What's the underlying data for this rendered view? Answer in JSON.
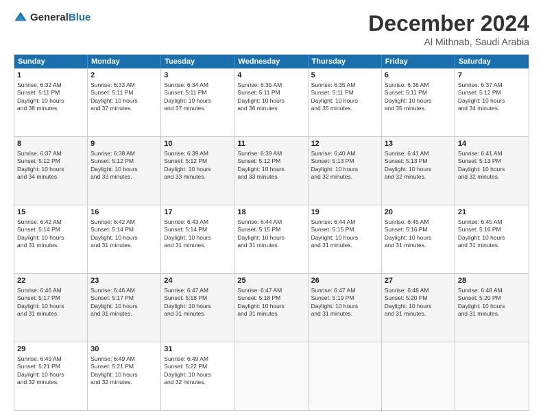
{
  "header": {
    "logo_general": "General",
    "logo_blue": "Blue",
    "month_title": "December 2024",
    "location": "Al Mithnab, Saudi Arabia"
  },
  "days_of_week": [
    "Sunday",
    "Monday",
    "Tuesday",
    "Wednesday",
    "Thursday",
    "Friday",
    "Saturday"
  ],
  "weeks": [
    [
      {
        "day": "1",
        "lines": [
          "Sunrise: 6:32 AM",
          "Sunset: 5:11 PM",
          "Daylight: 10 hours",
          "and 38 minutes."
        ]
      },
      {
        "day": "2",
        "lines": [
          "Sunrise: 6:33 AM",
          "Sunset: 5:11 PM",
          "Daylight: 10 hours",
          "and 37 minutes."
        ]
      },
      {
        "day": "3",
        "lines": [
          "Sunrise: 6:34 AM",
          "Sunset: 5:11 PM",
          "Daylight: 10 hours",
          "and 37 minutes."
        ]
      },
      {
        "day": "4",
        "lines": [
          "Sunrise: 6:35 AM",
          "Sunset: 5:11 PM",
          "Daylight: 10 hours",
          "and 36 minutes."
        ]
      },
      {
        "day": "5",
        "lines": [
          "Sunrise: 6:35 AM",
          "Sunset: 5:11 PM",
          "Daylight: 10 hours",
          "and 35 minutes."
        ]
      },
      {
        "day": "6",
        "lines": [
          "Sunrise: 6:36 AM",
          "Sunset: 5:11 PM",
          "Daylight: 10 hours",
          "and 35 minutes."
        ]
      },
      {
        "day": "7",
        "lines": [
          "Sunrise: 6:37 AM",
          "Sunset: 5:12 PM",
          "Daylight: 10 hours",
          "and 34 minutes."
        ]
      }
    ],
    [
      {
        "day": "8",
        "lines": [
          "Sunrise: 6:37 AM",
          "Sunset: 5:12 PM",
          "Daylight: 10 hours",
          "and 34 minutes."
        ]
      },
      {
        "day": "9",
        "lines": [
          "Sunrise: 6:38 AM",
          "Sunset: 5:12 PM",
          "Daylight: 10 hours",
          "and 33 minutes."
        ]
      },
      {
        "day": "10",
        "lines": [
          "Sunrise: 6:39 AM",
          "Sunset: 5:12 PM",
          "Daylight: 10 hours",
          "and 33 minutes."
        ]
      },
      {
        "day": "11",
        "lines": [
          "Sunrise: 6:39 AM",
          "Sunset: 5:12 PM",
          "Daylight: 10 hours",
          "and 33 minutes."
        ]
      },
      {
        "day": "12",
        "lines": [
          "Sunrise: 6:40 AM",
          "Sunset: 5:13 PM",
          "Daylight: 10 hours",
          "and 32 minutes."
        ]
      },
      {
        "day": "13",
        "lines": [
          "Sunrise: 6:41 AM",
          "Sunset: 5:13 PM",
          "Daylight: 10 hours",
          "and 32 minutes."
        ]
      },
      {
        "day": "14",
        "lines": [
          "Sunrise: 6:41 AM",
          "Sunset: 5:13 PM",
          "Daylight: 10 hours",
          "and 32 minutes."
        ]
      }
    ],
    [
      {
        "day": "15",
        "lines": [
          "Sunrise: 6:42 AM",
          "Sunset: 5:14 PM",
          "Daylight: 10 hours",
          "and 31 minutes."
        ]
      },
      {
        "day": "16",
        "lines": [
          "Sunrise: 6:42 AM",
          "Sunset: 5:14 PM",
          "Daylight: 10 hours",
          "and 31 minutes."
        ]
      },
      {
        "day": "17",
        "lines": [
          "Sunrise: 6:43 AM",
          "Sunset: 5:14 PM",
          "Daylight: 10 hours",
          "and 31 minutes."
        ]
      },
      {
        "day": "18",
        "lines": [
          "Sunrise: 6:44 AM",
          "Sunset: 5:15 PM",
          "Daylight: 10 hours",
          "and 31 minutes."
        ]
      },
      {
        "day": "19",
        "lines": [
          "Sunrise: 6:44 AM",
          "Sunset: 5:15 PM",
          "Daylight: 10 hours",
          "and 31 minutes."
        ]
      },
      {
        "day": "20",
        "lines": [
          "Sunrise: 6:45 AM",
          "Sunset: 5:16 PM",
          "Daylight: 10 hours",
          "and 31 minutes."
        ]
      },
      {
        "day": "21",
        "lines": [
          "Sunrise: 6:45 AM",
          "Sunset: 5:16 PM",
          "Daylight: 10 hours",
          "and 31 minutes."
        ]
      }
    ],
    [
      {
        "day": "22",
        "lines": [
          "Sunrise: 6:46 AM",
          "Sunset: 5:17 PM",
          "Daylight: 10 hours",
          "and 31 minutes."
        ]
      },
      {
        "day": "23",
        "lines": [
          "Sunrise: 6:46 AM",
          "Sunset: 5:17 PM",
          "Daylight: 10 hours",
          "and 31 minutes."
        ]
      },
      {
        "day": "24",
        "lines": [
          "Sunrise: 6:47 AM",
          "Sunset: 5:18 PM",
          "Daylight: 10 hours",
          "and 31 minutes."
        ]
      },
      {
        "day": "25",
        "lines": [
          "Sunrise: 6:47 AM",
          "Sunset: 5:18 PM",
          "Daylight: 10 hours",
          "and 31 minutes."
        ]
      },
      {
        "day": "26",
        "lines": [
          "Sunrise: 6:47 AM",
          "Sunset: 5:19 PM",
          "Daylight: 10 hours",
          "and 31 minutes."
        ]
      },
      {
        "day": "27",
        "lines": [
          "Sunrise: 6:48 AM",
          "Sunset: 5:20 PM",
          "Daylight: 10 hours",
          "and 31 minutes."
        ]
      },
      {
        "day": "28",
        "lines": [
          "Sunrise: 6:48 AM",
          "Sunset: 5:20 PM",
          "Daylight: 10 hours",
          "and 31 minutes."
        ]
      }
    ],
    [
      {
        "day": "29",
        "lines": [
          "Sunrise: 6:49 AM",
          "Sunset: 5:21 PM",
          "Daylight: 10 hours",
          "and 32 minutes."
        ]
      },
      {
        "day": "30",
        "lines": [
          "Sunrise: 6:49 AM",
          "Sunset: 5:21 PM",
          "Daylight: 10 hours",
          "and 32 minutes."
        ]
      },
      {
        "day": "31",
        "lines": [
          "Sunrise: 6:49 AM",
          "Sunset: 5:22 PM",
          "Daylight: 10 hours",
          "and 32 minutes."
        ]
      },
      {
        "day": "",
        "lines": []
      },
      {
        "day": "",
        "lines": []
      },
      {
        "day": "",
        "lines": []
      },
      {
        "day": "",
        "lines": []
      }
    ]
  ]
}
